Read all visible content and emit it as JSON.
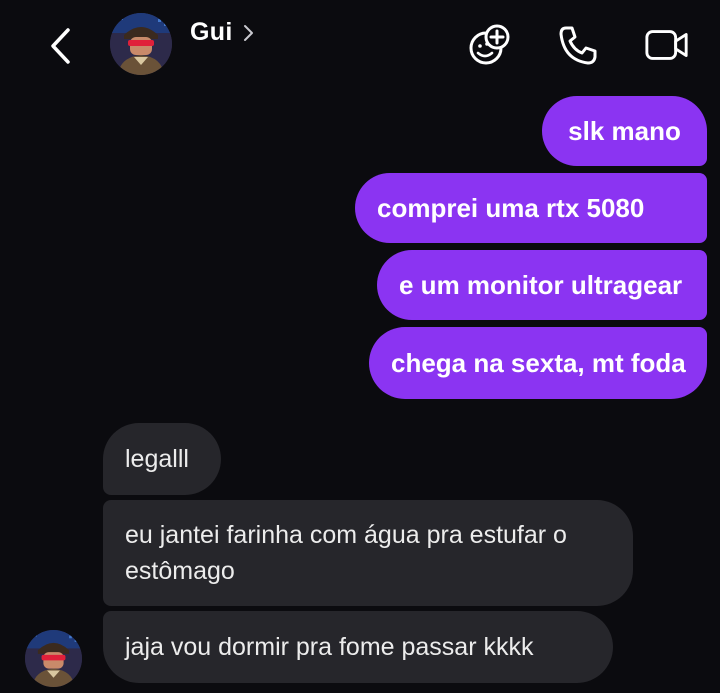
{
  "header": {
    "contact_name": "Gui",
    "icons": {
      "back": "back-arrow-icon",
      "chevron": "chevron-right-icon",
      "effects": "sticker-effects-icon",
      "call": "phone-icon",
      "video": "video-camera-icon"
    }
  },
  "messages": {
    "sent": [
      "slk mano",
      "comprei uma rtx 5080",
      "e um monitor ultragear",
      "chega na sexta, mt foda"
    ],
    "received": [
      "legalll",
      "eu jantei farinha com água pra estufar o estômago",
      "jaja vou dormir pra fome passar kkkk"
    ]
  },
  "colors": {
    "background": "#0b0b0f",
    "sent_bubble": "#8b34f2",
    "received_bubble": "#26262b"
  }
}
